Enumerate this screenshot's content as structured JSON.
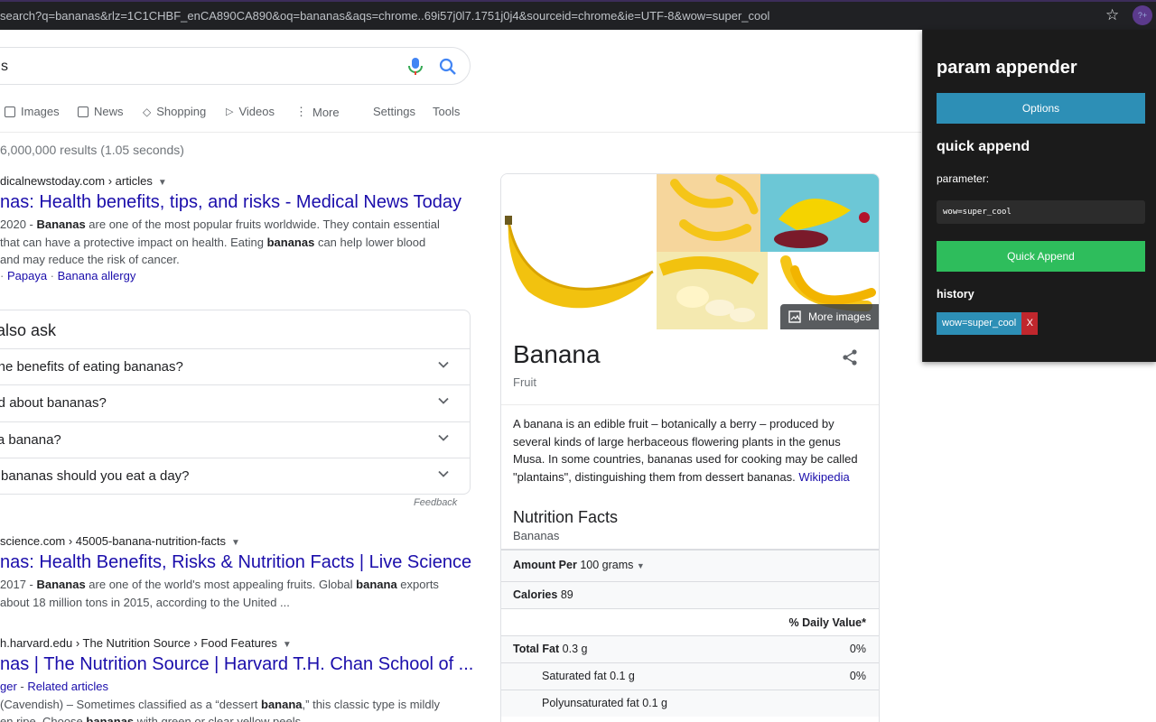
{
  "browser": {
    "url": "search?q=bananas&rlz=1C1CHBF_enCA890CA890&oq=bananas&aqs=chrome..69i57j0l7.1751j0j4&sourceid=chrome&ie=UTF-8&wow=super_cool",
    "star_icon": "star-icon",
    "extension_icon_text": "?+"
  },
  "search": {
    "query": "s",
    "tabs": [
      "Images",
      "News",
      "Shopping",
      "Videos",
      "More",
      "Settings",
      "Tools"
    ],
    "stats": "6,000,000 results (1.05 seconds)"
  },
  "results": [
    {
      "cite": "dicalnewstoday.com › articles",
      "title": "nas: Health benefits, tips, and risks - Medical News Today",
      "snippet_html": "2020 - <b>Bananas</b> are one of the most popular fruits worldwide. They contain essential<br>that can have a protective impact on health. Eating <b>bananas</b> can help lower blood<br>and may reduce the risk of cancer.",
      "sitelinks": [
        "Papaya",
        "Banana allergy"
      ]
    },
    {
      "cite": "science.com › 45005-banana-nutrition-facts",
      "title": "nas: Health Benefits, Risks & Nutrition Facts | Live Science",
      "snippet_html": "2017 - <b>Bananas</b> are one of the world's most appealing fruits. Global <b>banana</b> exports<br>about 18 million tons in 2015, according to the United ..."
    },
    {
      "cite": "h.harvard.edu › The Nutrition Source › Food Features",
      "title": "nas | The Nutrition Source | Harvard T.H. Chan School of ...",
      "pre": "ger",
      "related": "Related articles",
      "snippet_html": "(Cavendish) – Sometimes classified as a “dessert <b>banana</b>,” this classic type is mildly<br>en ripe. Choose <b>bananas</b> with green or clear yellow peels"
    }
  ],
  "paa": {
    "title": "e also ask",
    "questions": [
      "e the benefits of eating bananas?",
      "bad about bananas?",
      "in a banana?",
      "ny bananas should you eat a day?"
    ],
    "feedback": "Feedback"
  },
  "knowledge_panel": {
    "more_images": "More images",
    "title": "Banana",
    "subtitle": "Fruit",
    "description": "A banana is an edible fruit – botanically a berry – produced by several kinds of large herbaceous flowering plants in the genus Musa. In some countries, bananas used for cooking may be called \"plantains\", distinguishing them from dessert bananas.",
    "wikipedia": "Wikipedia",
    "nutrition": {
      "title": "Nutrition Facts",
      "subtitle": "Bananas",
      "amount_per_label": "Amount Per",
      "amount_per_value": "100 grams",
      "calories_label": "Calories",
      "calories_value": "89",
      "daily_value_label": "% Daily Value*",
      "rows": [
        {
          "label": "Total Fat",
          "value": "0.3 g",
          "pct": "0%"
        },
        {
          "label": "Saturated fat",
          "value": "0.1 g",
          "pct": "0%"
        },
        {
          "label": "Polyunsaturated fat",
          "value": "0.1 g",
          "pct": ""
        }
      ]
    }
  },
  "popup": {
    "title": "param appender",
    "options_button": "Options",
    "section_title": "quick append",
    "parameter_label": "parameter:",
    "parameter_value": "wow=super_cool",
    "quick_append_button": "Quick Append",
    "history_title": "history",
    "history": [
      {
        "value": "wow=super_cool",
        "remove": "X"
      }
    ]
  }
}
